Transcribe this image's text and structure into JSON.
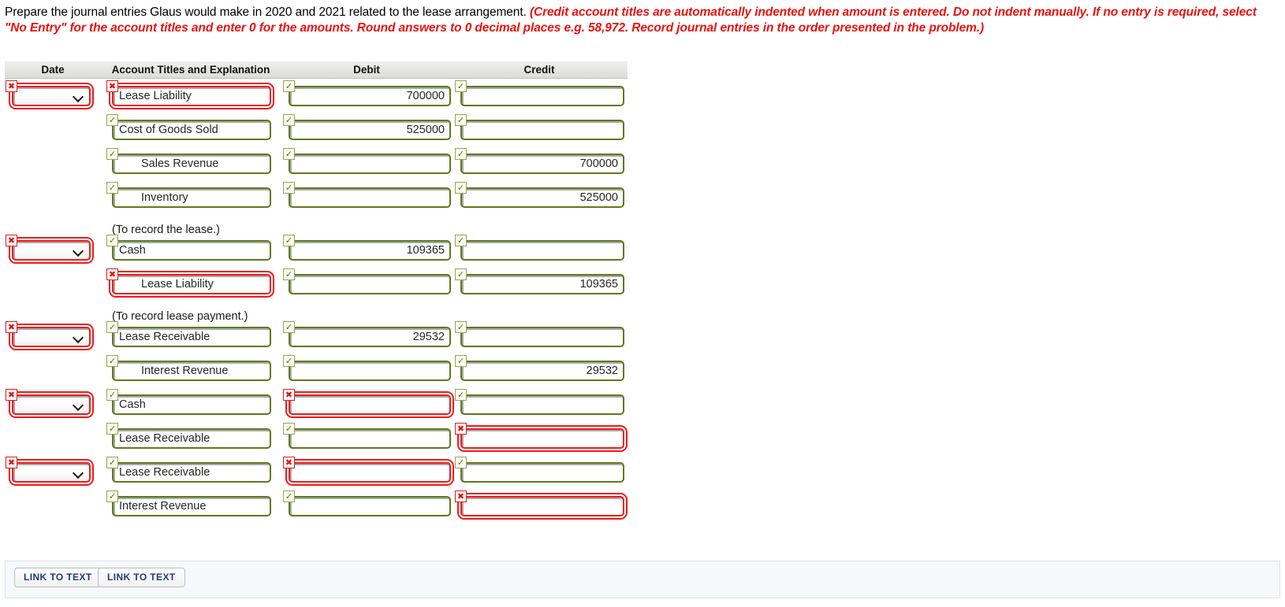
{
  "instructions": {
    "lead": "Prepare the journal entries Glaus would make in 2020 and 2021 related to the lease arrangement.",
    "hint": "(Credit account titles are automatically indented when amount is entered. Do not indent manually. If no entry is required, select \"No Entry\" for the account titles and enter 0 for the amounts. Round answers to 0 decimal places e.g. 58,972. Record journal entries in the order presented in the problem.)"
  },
  "table": {
    "headers": {
      "date": "Date",
      "account": "Account Titles and Explanation",
      "debit": "Debit",
      "credit": "Credit"
    },
    "rows": [
      {
        "type": "entry",
        "date": {
          "value": "",
          "status": "incorrect"
        },
        "account": {
          "value": "Lease Liability",
          "indented": false,
          "status": "incorrect"
        },
        "debit": {
          "value": "700000",
          "status": "correct"
        },
        "credit": {
          "value": "",
          "status": "correct"
        }
      },
      {
        "type": "entry",
        "date": null,
        "account": {
          "value": "Cost of Goods Sold",
          "indented": false,
          "status": "correct"
        },
        "debit": {
          "value": "525000",
          "status": "correct"
        },
        "credit": {
          "value": "",
          "status": "correct"
        }
      },
      {
        "type": "entry",
        "date": null,
        "account": {
          "value": "Sales Revenue",
          "indented": true,
          "status": "correct"
        },
        "debit": {
          "value": "",
          "status": "correct"
        },
        "credit": {
          "value": "700000",
          "status": "correct"
        }
      },
      {
        "type": "entry",
        "date": null,
        "account": {
          "value": "Inventory",
          "indented": true,
          "status": "correct"
        },
        "debit": {
          "value": "",
          "status": "correct"
        },
        "credit": {
          "value": "525000",
          "status": "correct"
        }
      },
      {
        "type": "note",
        "text": "(To record the lease.)"
      },
      {
        "type": "entry",
        "date": {
          "value": "",
          "status": "incorrect"
        },
        "account": {
          "value": "Cash",
          "indented": false,
          "status": "correct"
        },
        "debit": {
          "value": "109365",
          "status": "correct"
        },
        "credit": {
          "value": "",
          "status": "correct"
        }
      },
      {
        "type": "entry",
        "date": null,
        "account": {
          "value": "Lease Liability",
          "indented": true,
          "status": "incorrect"
        },
        "debit": {
          "value": "",
          "status": "correct"
        },
        "credit": {
          "value": "109365",
          "status": "correct"
        }
      },
      {
        "type": "note",
        "text": "(To record lease payment.)"
      },
      {
        "type": "entry",
        "date": {
          "value": "",
          "status": "incorrect"
        },
        "account": {
          "value": "Lease Receivable",
          "indented": false,
          "status": "correct"
        },
        "debit": {
          "value": "29532",
          "status": "correct"
        },
        "credit": {
          "value": "",
          "status": "correct"
        }
      },
      {
        "type": "entry",
        "date": null,
        "account": {
          "value": "Interest Revenue",
          "indented": true,
          "status": "correct"
        },
        "debit": {
          "value": "",
          "status": "correct"
        },
        "credit": {
          "value": "29532",
          "status": "correct"
        }
      },
      {
        "type": "entry",
        "date": {
          "value": "",
          "status": "incorrect"
        },
        "account": {
          "value": "Cash",
          "indented": false,
          "status": "correct"
        },
        "debit": {
          "value": "",
          "status": "incorrect"
        },
        "credit": {
          "value": "",
          "status": "correct"
        }
      },
      {
        "type": "entry",
        "date": null,
        "account": {
          "value": "Lease Receivable",
          "indented": false,
          "status": "correct"
        },
        "debit": {
          "value": "",
          "status": "correct"
        },
        "credit": {
          "value": "",
          "status": "incorrect"
        }
      },
      {
        "type": "entry",
        "date": {
          "value": "",
          "status": "incorrect"
        },
        "account": {
          "value": "Lease Receivable",
          "indented": false,
          "status": "correct"
        },
        "debit": {
          "value": "",
          "status": "incorrect"
        },
        "credit": {
          "value": "",
          "status": "correct"
        }
      },
      {
        "type": "entry",
        "date": null,
        "account": {
          "value": "Interest Revenue",
          "indented": false,
          "status": "correct"
        },
        "debit": {
          "value": "",
          "status": "correct"
        },
        "credit": {
          "value": "",
          "status": "incorrect"
        }
      }
    ]
  },
  "markers": {
    "correct_glyph": "✓",
    "incorrect_glyph": "✖"
  },
  "footer": {
    "link_to_text_1": "LINK TO TEXT",
    "link_to_text_2": "LINK TO TEXT"
  },
  "colors": {
    "hint_red": "#e8130e",
    "correct_green": "#5e7a1b",
    "incorrect_red": "#ee1c1c",
    "header_bg": "#e4e4e0",
    "footer_bg": "#f6f8fb"
  }
}
